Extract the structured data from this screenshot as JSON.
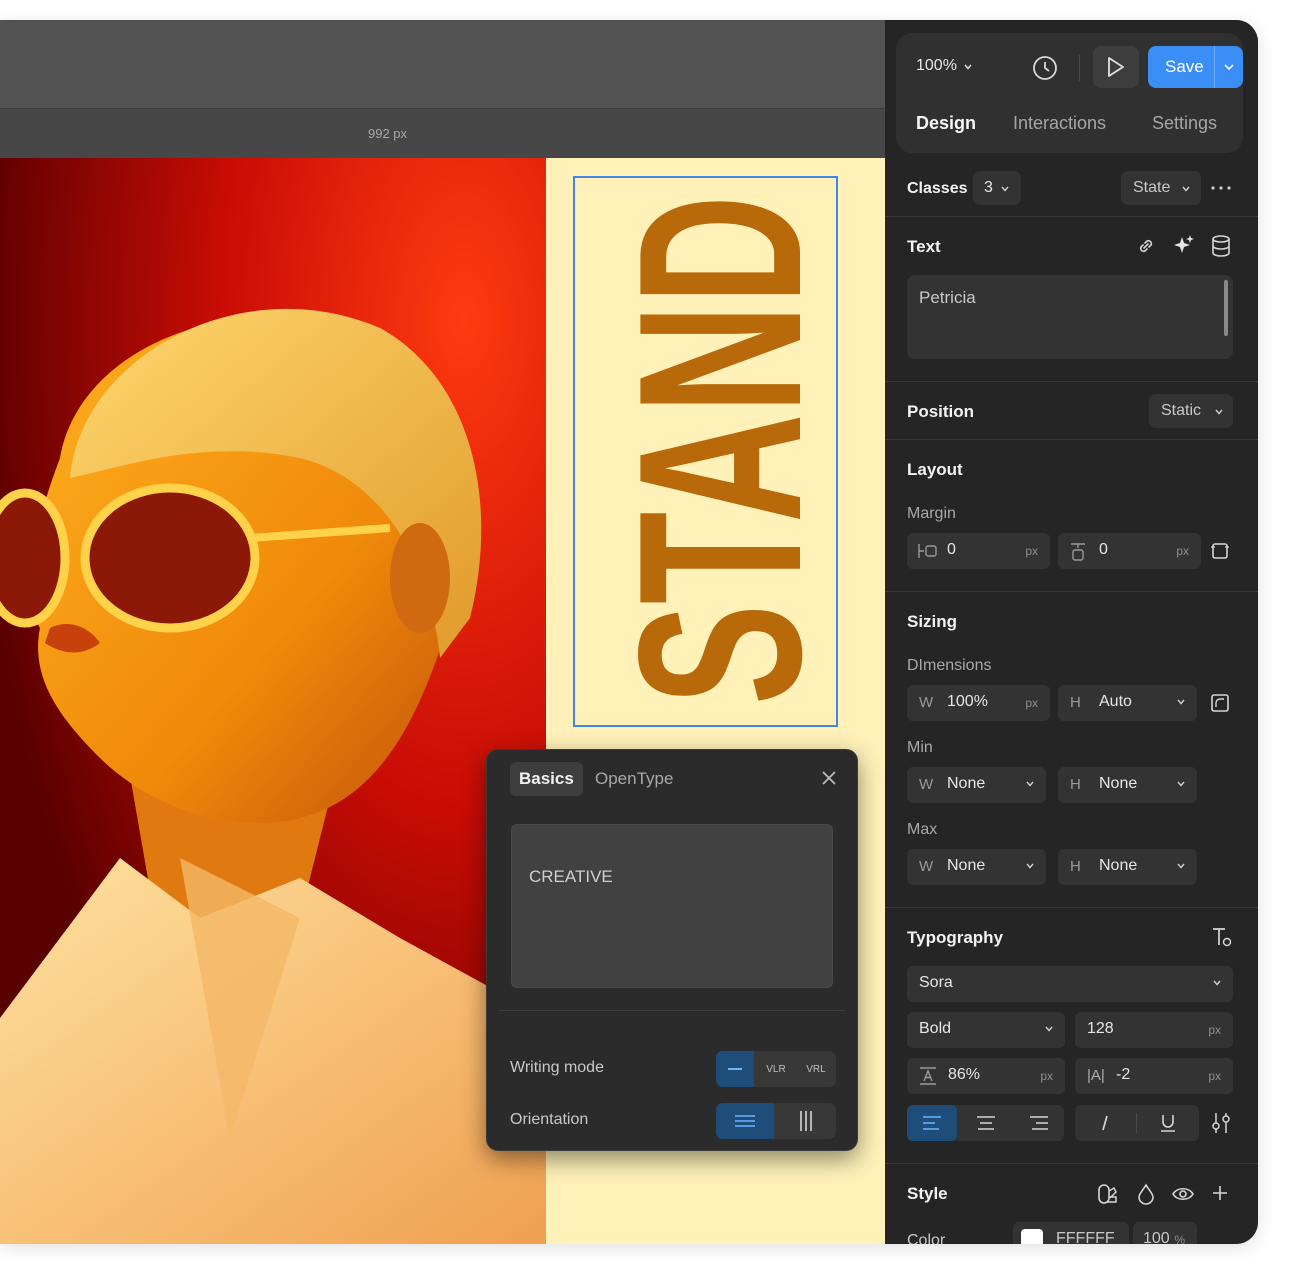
{
  "ruler": {
    "width_label": "992 px"
  },
  "canvas": {
    "headline": "STAND"
  },
  "toolbar": {
    "zoom": "100%",
    "save_label": "Save"
  },
  "tabs": [
    {
      "label": "Design"
    },
    {
      "label": "Interactions"
    },
    {
      "label": "Settings"
    }
  ],
  "classes": {
    "label": "Classes",
    "count": "3",
    "state_label": "State"
  },
  "text_section": {
    "title": "Text",
    "value": "Petricia"
  },
  "position": {
    "title": "Position",
    "value": "Static"
  },
  "layout": {
    "title": "Layout",
    "margin_label": "Margin",
    "margin_left": "0",
    "margin_top": "0",
    "unit": "px"
  },
  "sizing": {
    "title": "Sizing",
    "dimensions_label": "DImensions",
    "width_prefix": "W",
    "width_value": "100%",
    "width_unit": "px",
    "height_prefix": "H",
    "height_value": "Auto",
    "min_label": "Min",
    "min_w": "None",
    "min_h": "None",
    "max_label": "Max",
    "max_w": "None",
    "max_h": "None"
  },
  "typography": {
    "title": "Typography",
    "font": "Sora",
    "weight": "Bold",
    "size": "128",
    "size_unit": "px",
    "line_height": "86%",
    "line_height_unit": "px",
    "letter_spacing_prefix": "|A|",
    "letter_spacing": "-2",
    "letter_spacing_unit": "px"
  },
  "style": {
    "title": "Style",
    "color_label": "Color",
    "color_hex": "FFFFFF",
    "opacity": "100",
    "opacity_unit": "%"
  },
  "float_panel": {
    "tab_basics": "Basics",
    "tab_opentype": "OpenType",
    "preview_text": "CREATIVE",
    "writing_mode_label": "Writing mode",
    "writing_mode_options": [
      "VLR",
      "VRL"
    ],
    "orientation_label": "Orientation"
  },
  "colors": {
    "accent": "#3a8ef5",
    "headline": "#b8690a",
    "canvas_bg": "#fff1b8"
  }
}
